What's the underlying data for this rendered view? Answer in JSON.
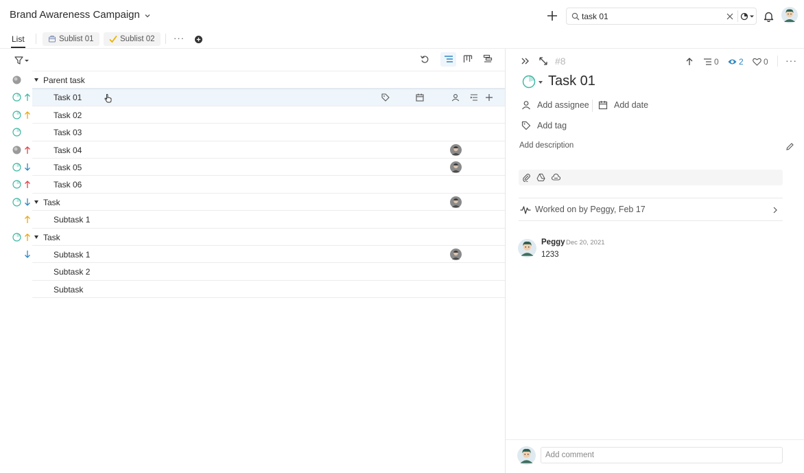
{
  "header": {
    "project_title": "Brand Awareness Campaign",
    "search_value": "task 01"
  },
  "tabs": {
    "list_label": "List",
    "sublists": [
      {
        "label": "Sublist 01"
      },
      {
        "label": "Sublist 02"
      }
    ],
    "more_label": "···"
  },
  "rows": [
    {
      "name": "Parent task",
      "status": "gray",
      "priority": "none",
      "expandable": true,
      "indent": 0,
      "assignee": false
    },
    {
      "name": "Task 01",
      "status": "open",
      "priority": "high",
      "expandable": false,
      "indent": 1,
      "assignee": false,
      "highlighted": true
    },
    {
      "name": "Task 02",
      "status": "open",
      "priority": "medium",
      "expandable": false,
      "indent": 1,
      "assignee": false
    },
    {
      "name": "Task 03",
      "status": "open",
      "priority": "none",
      "expandable": false,
      "indent": 1,
      "assignee": false
    },
    {
      "name": "Task 04",
      "status": "gray",
      "priority": "urgent",
      "expandable": false,
      "indent": 1,
      "assignee": true
    },
    {
      "name": "Task 05",
      "status": "open",
      "priority": "low",
      "expandable": false,
      "indent": 1,
      "assignee": true
    },
    {
      "name": "Task 06",
      "status": "open",
      "priority": "urgent",
      "expandable": false,
      "indent": 1,
      "assignee": false
    },
    {
      "name": "Task",
      "status": "open",
      "priority": "low",
      "expandable": true,
      "indent": 0,
      "assignee": true
    },
    {
      "name": "Subtask 1",
      "status": "none",
      "priority": "medium",
      "expandable": false,
      "indent": 1,
      "assignee": false
    },
    {
      "name": "Task",
      "status": "open",
      "priority": "medium",
      "expandable": true,
      "indent": 0,
      "assignee": false
    },
    {
      "name": "Subtask 1",
      "status": "none",
      "priority": "low",
      "expandable": false,
      "indent": 1,
      "assignee": true
    },
    {
      "name": "Subtask 2",
      "status": "none",
      "priority": "none",
      "expandable": false,
      "indent": 1,
      "assignee": false
    },
    {
      "name": "Subtask",
      "status": "none",
      "priority": "none",
      "expandable": false,
      "indent": 1,
      "assignee": false
    }
  ],
  "detail": {
    "task_id": "#8",
    "subtask_count": "0",
    "watcher_count": "2",
    "like_count": "0",
    "title": "Task 01",
    "add_assignee": "Add assignee",
    "add_date": "Add date",
    "add_tag": "Add tag",
    "add_description": "Add description",
    "activity_text": "Worked on by Peggy, Feb 17",
    "comment": {
      "author": "Peggy",
      "date": "Dec 20, 2021",
      "body": "1233"
    },
    "comment_placeholder": "Add comment"
  },
  "colors": {
    "accent": "#2e86c1",
    "status_open": "#3fb8a4",
    "priority_urgent": "#e0424a",
    "priority_high": "#3fb8a4",
    "priority_medium": "#f0a800",
    "priority_low": "#2e86c1",
    "watch_blue": "#2e86c1"
  }
}
